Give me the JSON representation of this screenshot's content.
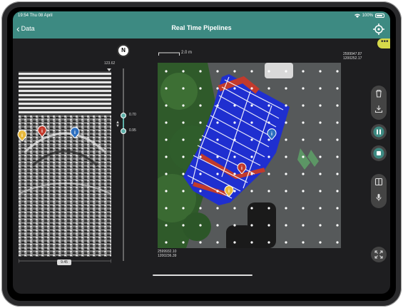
{
  "status": {
    "time": "19:54 Thu 08 April",
    "wifi": "wifi-icon",
    "battery": "100%"
  },
  "nav": {
    "back_label": "Data",
    "title": "Real Time Pipelines"
  },
  "more_label": "•••",
  "compass_label": "N",
  "scan": {
    "top_value": "123.62",
    "bottom_value": "9.45"
  },
  "slider": {
    "upper_value": "0.70",
    "lower_value": "0.95"
  },
  "map": {
    "scale_label": "2.0 m",
    "coord_top_right_1": "2599947.87",
    "coord_top_right_2": "1200252.17",
    "coord_bottom_left_1": "2599932.10",
    "coord_bottom_left_2": "1200236.39"
  },
  "colors": {
    "accent": "#3d8a82",
    "yellow": "#e8b83a",
    "red": "#c23a2c",
    "blue": "#2d6fc0",
    "highlight": "#d6d94a"
  },
  "markers": [
    {
      "color": "yellow",
      "label": "i"
    },
    {
      "color": "red",
      "label": "i"
    },
    {
      "color": "blue",
      "label": "i"
    }
  ],
  "controls": [
    "trash-icon",
    "download-icon",
    "pause-icon",
    "stop-icon",
    "split-icon",
    "microphone-icon",
    "expand-icon"
  ]
}
